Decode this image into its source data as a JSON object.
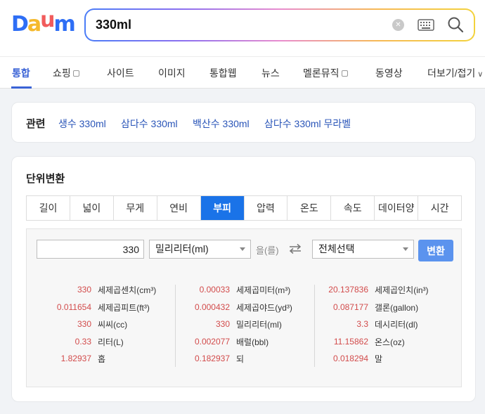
{
  "logo": {
    "letters": [
      "D",
      "a",
      "u",
      "m"
    ],
    "colors": [
      "#2e6ef5",
      "#f5b92c",
      "#f15b5b",
      "#2e6ef5"
    ]
  },
  "search": {
    "value": "330ml",
    "clear_icon": "close-circle-icon",
    "keyboard_icon": "keyboard-icon",
    "search_icon": "magnifier-icon"
  },
  "nav": {
    "items": [
      "통합",
      "쇼핑",
      "사이트",
      "이미지",
      "통합웹",
      "뉴스",
      "멜론뮤직",
      "동영상",
      "더보기/접기"
    ],
    "active": "통합",
    "accent": "#3a63d6"
  },
  "related": {
    "title": "관련",
    "links": [
      "생수 330ml",
      "삼다수 330ml",
      "백산수 330ml",
      "삼다수 330ml 무라벨"
    ]
  },
  "converter": {
    "title": "단위변환",
    "tabs": [
      "길이",
      "넓이",
      "무게",
      "연비",
      "부피",
      "압력",
      "온도",
      "속도",
      "데이터양",
      "시간"
    ],
    "active_tab": "부피",
    "input_value": "330",
    "from_unit": "밀리리터(ml)",
    "connector": "을(를)",
    "to_unit": "전체선택",
    "convert_label": "변환",
    "results": [
      [
        {
          "value": "330",
          "unit": "세제곱센치(cm³)"
        },
        {
          "value": "0.011654",
          "unit": "세제곱피트(ft³)"
        },
        {
          "value": "330",
          "unit": "씨씨(cc)"
        },
        {
          "value": "0.33",
          "unit": "리터(L)"
        },
        {
          "value": "1.82937",
          "unit": "홉"
        }
      ],
      [
        {
          "value": "0.00033",
          "unit": "세제곱미터(m³)"
        },
        {
          "value": "0.000432",
          "unit": "세제곱야드(yd³)"
        },
        {
          "value": "330",
          "unit": "밀리리터(ml)"
        },
        {
          "value": "0.002077",
          "unit": "배럴(bbl)"
        },
        {
          "value": "0.182937",
          "unit": "되"
        }
      ],
      [
        {
          "value": "20.137836",
          "unit": "세제곱인치(in³)"
        },
        {
          "value": "0.087177",
          "unit": "갤론(gallon)"
        },
        {
          "value": "3.3",
          "unit": "데시리터(dl)"
        },
        {
          "value": "11.15862",
          "unit": "온스(oz)"
        },
        {
          "value": "0.018294",
          "unit": "말"
        }
      ]
    ]
  }
}
